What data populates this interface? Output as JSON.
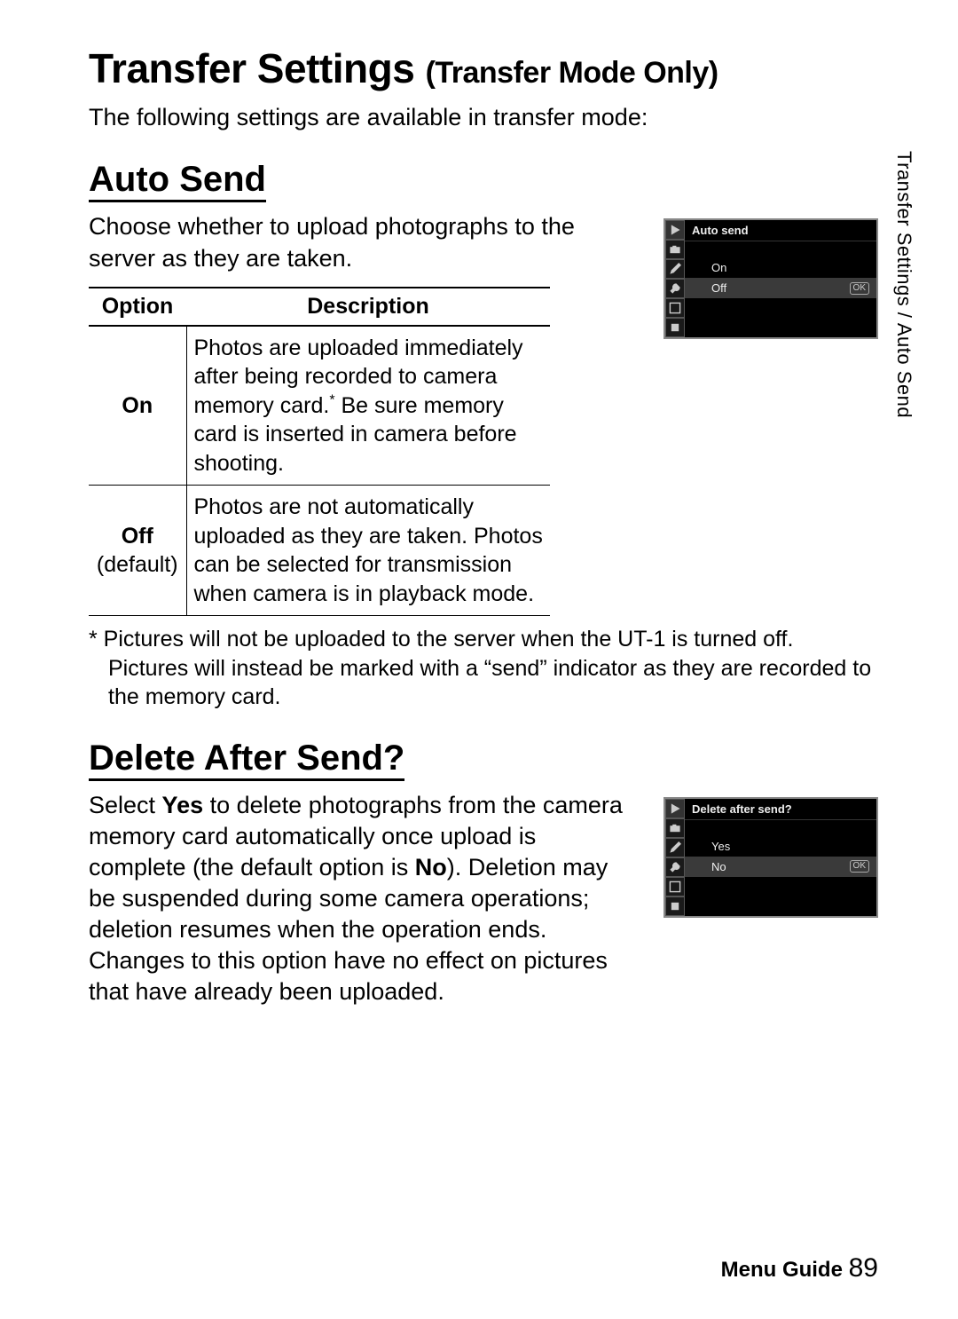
{
  "page_title": "Transfer Settings",
  "page_title_suffix": "(Transfer Mode Only)",
  "intro": "The following settings are available in transfer mode:",
  "sidetab": "Transfer Settings / Auto Send",
  "auto_send": {
    "heading": "Auto Send",
    "text": "Choose whether to upload photographs to the server as they are taken.",
    "col_option": "Option",
    "col_desc": "Description",
    "rows": [
      {
        "option": "On",
        "default_label": "",
        "desc_pre": "Photos are uploaded immediately after being recorded to camera memory card.",
        "desc_post": " Be sure memory card is inserted in camera before shooting."
      },
      {
        "option": "Off",
        "default_label": "(default)",
        "desc_pre": "Photos are not automatically uploaded as they are taken.  Photos can be selected for transmission when camera is in playback mode.",
        "desc_post": ""
      }
    ],
    "footnote": "* Pictures will not be uploaded to the server when the UT-1 is turned off. Pictures will instead be marked with a “send” indicator as they are recorded to the memory card.",
    "lcd": {
      "title": "Auto send",
      "opt1": "On",
      "opt2": "Off",
      "ok": "OK"
    }
  },
  "delete_after": {
    "heading": "Delete After Send?",
    "text_pre": "Select ",
    "text_yes": "Yes",
    "text_mid": " to delete photographs from the camera memory card automatically once upload is complete (the default option is ",
    "text_no": "No",
    "text_post": "). Deletion may be suspended during some camera operations; deletion resumes when the operation ends. Changes to this option have no effect on pictures that have already been uploaded.",
    "lcd": {
      "title": "Delete after send?",
      "opt1": "Yes",
      "opt2": "No",
      "ok": "OK"
    }
  },
  "footer_label": "Menu Guide",
  "footer_page": "89"
}
